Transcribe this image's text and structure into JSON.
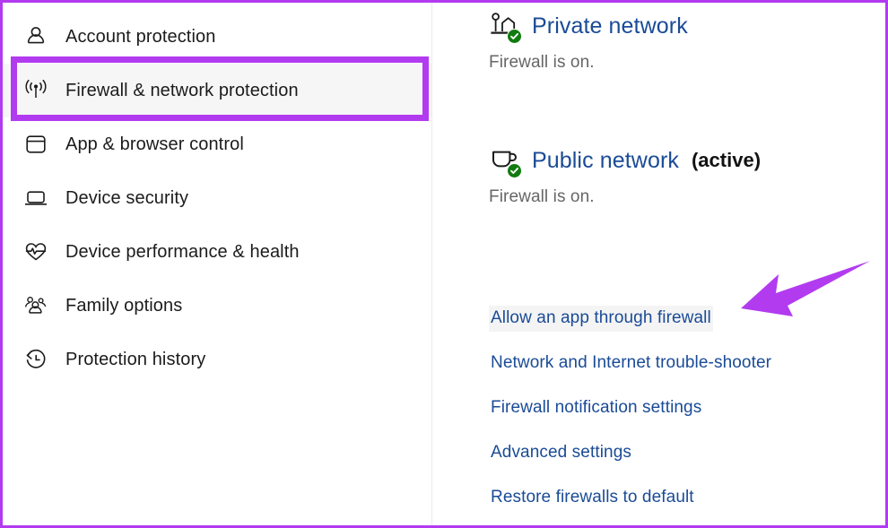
{
  "theme": {
    "annotation_purple": "#b23bf0",
    "link_blue": "#1a4b96",
    "status_gray": "#666666",
    "check_green": "#107c10",
    "selected_bg": "#f6f6f6"
  },
  "sidebar": {
    "items": [
      {
        "label": "Account protection",
        "icon": "person-icon",
        "selected": false
      },
      {
        "label": "Firewall & network protection",
        "icon": "wifi-signal-icon",
        "selected": true
      },
      {
        "label": "App & browser control",
        "icon": "app-window-icon",
        "selected": false
      },
      {
        "label": "Device security",
        "icon": "laptop-icon",
        "selected": false
      },
      {
        "label": "Device performance & health",
        "icon": "heart-pulse-icon",
        "selected": false
      },
      {
        "label": "Family options",
        "icon": "people-group-icon",
        "selected": false
      },
      {
        "label": "Protection history",
        "icon": "clock-history-icon",
        "selected": false
      }
    ]
  },
  "content": {
    "networks": [
      {
        "title": "Private network",
        "badge": "",
        "status": "Firewall is on.",
        "icon": "private-network-home-icon"
      },
      {
        "title": "Public network",
        "badge": "(active)",
        "status": "Firewall is on.",
        "icon": "public-network-cafe-icon"
      }
    ],
    "links": [
      {
        "label": "Allow an app through firewall",
        "hovered": true
      },
      {
        "label": "Network and Internet trouble-shooter",
        "hovered": false
      },
      {
        "label": "Firewall notification settings",
        "hovered": false
      },
      {
        "label": "Advanced settings",
        "hovered": false
      },
      {
        "label": "Restore firewalls to default",
        "hovered": false
      }
    ]
  },
  "annotations": {
    "highlight_box_target": "Firewall & network protection",
    "arrow_target": "Allow an app through firewall"
  }
}
